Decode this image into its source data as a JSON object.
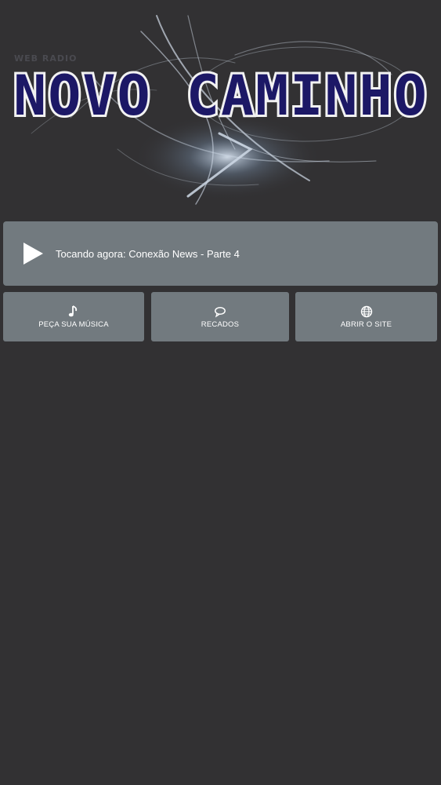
{
  "banner": {
    "subtitle": "WEB RADIO",
    "title": "NOVO CAMINHO"
  },
  "player": {
    "now_playing": "Tocando agora: Conexão News - Parte 4",
    "play_icon": "play-icon"
  },
  "actions": [
    {
      "label": "PEÇA SUA MÚSICA",
      "icon": "music-note-icon"
    },
    {
      "label": "RECADOS",
      "icon": "chat-bubble-icon"
    },
    {
      "label": "ABRIR O SITE",
      "icon": "globe-icon"
    }
  ],
  "colors": {
    "background": "#323133",
    "card": "#727a7f",
    "logo_fill": "#1c1866",
    "text": "#ffffff"
  }
}
